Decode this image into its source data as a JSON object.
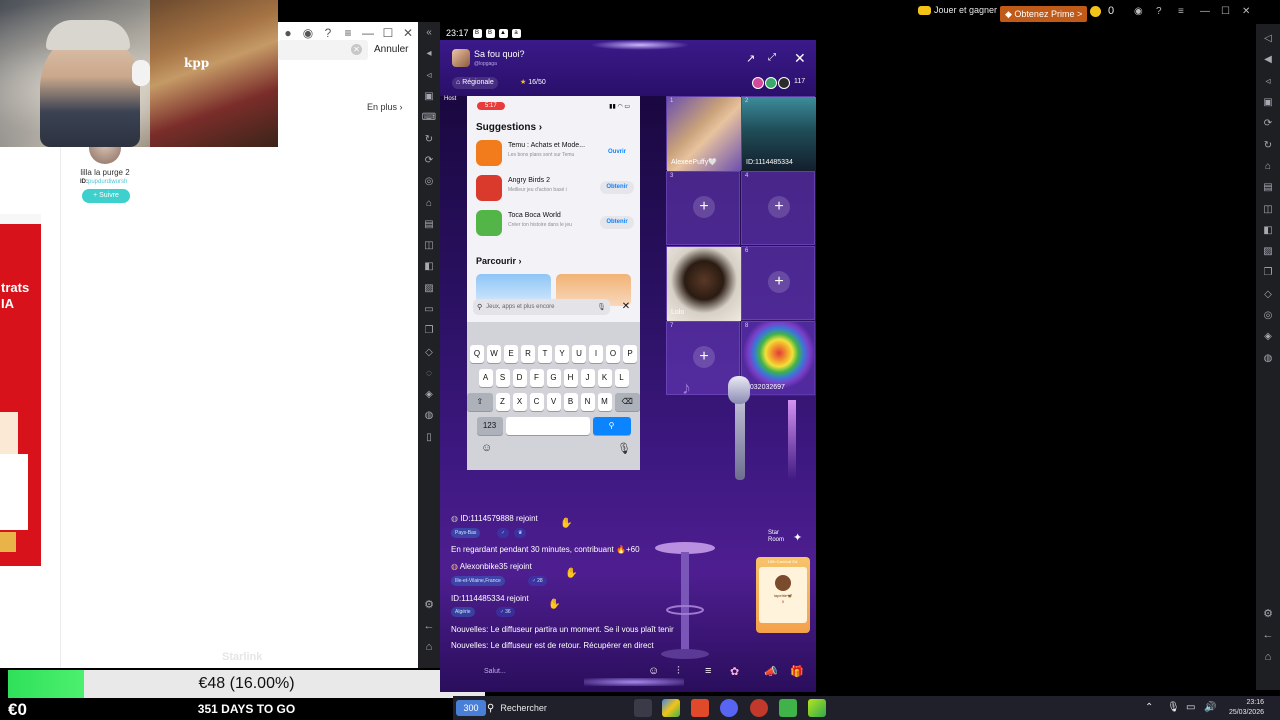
{
  "left_window": {
    "search_cancel": "Annuler",
    "more_link": "En plus",
    "profile": {
      "name": "lilla la purge 2",
      "id_prefix": "ID:",
      "id_value": "pupdurdiwursh",
      "follow": "+ Suivre"
    },
    "ad": {
      "headline_line1": "trats",
      "headline_line2": "IA"
    },
    "watermark": "Starlink"
  },
  "stream_overlay": {
    "goal_label": "€48 (16.00%)",
    "goal_progress": 0.16,
    "balance": "€0",
    "countdown": "351 DAYS TO GO"
  },
  "phone": {
    "status_time": "23:17",
    "room": {
      "title": "Sa fou quoi?",
      "subtitle": "@lopgaga",
      "region": "Régionale",
      "count": "16/50",
      "viewers": "117",
      "host_label": "Host"
    },
    "screen_share": {
      "ios_time": "5:17",
      "suggestions_title": "Suggestions",
      "apps": [
        {
          "name": "Temu : Achats et Mode...",
          "desc": "Les bons plans sont sur Temu",
          "button": "Ouvrir",
          "color": "#f27b1b"
        },
        {
          "name": "Angry Birds 2",
          "desc": "Meilleur jeu d'action basé i",
          "button": "Obtenir",
          "color": "#d93a2b"
        },
        {
          "name": "Toca Boca World",
          "desc": "Créer ton histoire dans le jeu",
          "button": "Obtenir",
          "color": "#53b548"
        }
      ],
      "browse_title": "Parcourir",
      "search_placeholder": "Jeux, apps et plus encore",
      "keyboard": {
        "row1": [
          "Q",
          "W",
          "E",
          "R",
          "T",
          "Y",
          "U",
          "I",
          "O",
          "P"
        ],
        "row2": [
          "A",
          "S",
          "D",
          "F",
          "G",
          "H",
          "J",
          "K",
          "L"
        ],
        "row3": [
          "Z",
          "X",
          "C",
          "V",
          "B",
          "N",
          "M"
        ],
        "numbers_key": "123"
      }
    },
    "seats": [
      {
        "num": "1",
        "name": "AlexeePuffy🤍"
      },
      {
        "num": "2",
        "name": "ID:1114485334"
      },
      {
        "num": "3",
        "name": ""
      },
      {
        "num": "4",
        "name": ""
      },
      {
        "num": "5",
        "name": "Lolo"
      },
      {
        "num": "6",
        "name": ""
      },
      {
        "num": "7",
        "name": ""
      },
      {
        "num": "8",
        "name": "1032032697"
      }
    ],
    "chat": {
      "line1": "ID:1114579888 rejoint",
      "tag1": "Pays-Bas",
      "line2": "En regardant pendant 30 minutes, contribuant 🔥+60",
      "line3": "Alexonbike35 rejoint",
      "tag3": "Ille-et-Vilaine,France",
      "age3": "♂ 28",
      "line4": "ID:1114485334 rejoint",
      "tag4": "Algérie",
      "age4": "♂ 36",
      "line5": "Nouvelles: Le diffuseur partira un moment. Se il vous plaît tenir",
      "line6": "Nouvelles: Le diffuseur est de retour. Récupérer en direct",
      "input_placeholder": "Salut..."
    },
    "star_room": {
      "label_line1": "Star",
      "label_line2": "Room",
      "card_title": "10th Carnival Ed.",
      "card_name": "lapetite🦋",
      "card_score": "0"
    }
  },
  "emulator": {
    "play_and_win": "Jouer et gagner",
    "prime": "Obtenez Prime >",
    "coins": "0"
  },
  "taskbar": {
    "weather": "300",
    "search": "Rechercher",
    "time": "23:16",
    "date": "25/03/2026"
  }
}
